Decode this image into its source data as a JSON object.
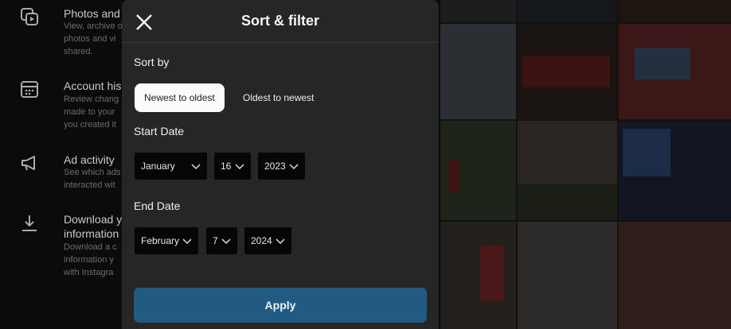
{
  "sidebar": {
    "items": [
      {
        "icon": "photos-icon",
        "title": "Photos and",
        "desc": "View, archive o\nphotos and vi\nshared."
      },
      {
        "icon": "calendar-icon",
        "title": "Account hist",
        "desc": "Review chang\nmade to your\nyou created it"
      },
      {
        "icon": "megaphone-icon",
        "title": "Ad activity",
        "desc": "See which ads\ninteracted wit"
      },
      {
        "icon": "download-icon",
        "title": "Download y\ninformation",
        "desc": "Download a c\ninformation y\nwith Instagra"
      }
    ]
  },
  "modal": {
    "title": "Sort & filter",
    "sort_by_label": "Sort by",
    "sort_options": [
      "Newest to oldest",
      "Oldest to newest"
    ],
    "selected_sort": "Newest to oldest",
    "start_date_label": "Start Date",
    "start_date": {
      "month": "January",
      "day": "16",
      "year": "2023"
    },
    "end_date_label": "End Date",
    "end_date": {
      "month": "February",
      "day": "7",
      "year": "2024"
    },
    "apply_label": "Apply"
  },
  "colors": {
    "modal_bg": "#262626",
    "apply_button": "#205b84",
    "selected_pill": "#fbfbfb",
    "select_bg": "#060606"
  }
}
